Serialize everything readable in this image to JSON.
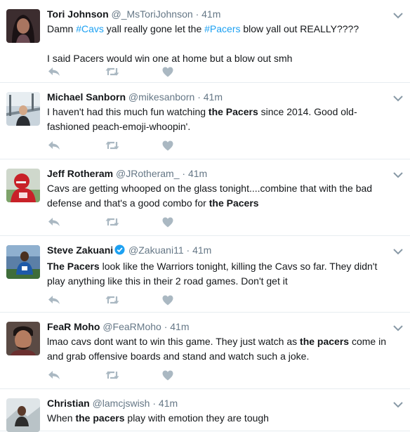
{
  "tweets": [
    {
      "name": "Tori Johnson",
      "handle": "@_MsToriJohnson",
      "sep": "·",
      "time": "41m",
      "verified": false,
      "avatar_icon": "avatar-woman",
      "lines": [
        [
          {
            "t": "Damn "
          },
          {
            "t": "#Cavs",
            "s": "link"
          },
          {
            "t": " yall really gone let the "
          },
          {
            "t": "#Pacers",
            "s": "link"
          },
          {
            "t": " blow yall out REALLY????"
          }
        ],
        [],
        [
          {
            "t": "I said Pacers would win one at home but a blow out smh"
          }
        ]
      ]
    },
    {
      "name": "Michael Sanborn",
      "handle": "@mikesanborn",
      "sep": "·",
      "time": "41m",
      "verified": false,
      "avatar_icon": "avatar-bridge",
      "lines": [
        [
          {
            "t": "I haven't had this much fun watching "
          },
          {
            "t": "the Pacers",
            "s": "bold"
          },
          {
            "t": " since 2014. Good old-fashioned peach-emoji-whoopin'."
          }
        ]
      ]
    },
    {
      "name": "Jeff Rotheram",
      "handle": "@JRotheram_",
      "sep": "·",
      "time": "41m",
      "verified": false,
      "avatar_icon": "avatar-football",
      "lines": [
        [
          {
            "t": "Cavs are getting whooped on the glass tonight....combine that with the bad defense and that's a good combo for "
          },
          {
            "t": "the Pacers",
            "s": "bold"
          }
        ]
      ]
    },
    {
      "name": "Steve Zakuani",
      "handle": "@Zakuani11",
      "sep": "·",
      "time": "41m",
      "verified": true,
      "avatar_icon": "avatar-soccer",
      "lines": [
        [
          {
            "t": "The Pacers",
            "s": "bold"
          },
          {
            "t": " look like the Warriors tonight, killing the Cavs so far. They didn't play anything like this in their 2 road games. Don't get it"
          }
        ]
      ]
    },
    {
      "name": "FeaR Moho",
      "handle": "@FeaRMoho",
      "sep": "·",
      "time": "41m",
      "verified": false,
      "avatar_icon": "avatar-man",
      "lines": [
        [
          {
            "t": "lmao cavs dont want to win this game. They just watch as "
          },
          {
            "t": "the pacers",
            "s": "bold"
          },
          {
            "t": " come in and grab offensive boards and stand and watch such a joke."
          }
        ]
      ]
    },
    {
      "name": "Christian",
      "handle": "@lamcjswish",
      "sep": "·",
      "time": "41m",
      "verified": false,
      "avatar_icon": "avatar-outdoor",
      "lines": [
        [
          {
            "t": "When "
          },
          {
            "t": "the pacers",
            "s": "bold"
          },
          {
            "t": " play with emotion they are tough"
          }
        ]
      ]
    }
  ],
  "icons": {
    "reply": "reply-icon",
    "retweet": "retweet-icon",
    "like": "heart-icon",
    "more": "chevron-down-icon",
    "verified": "verified-badge-icon"
  },
  "colors": {
    "link": "#1da1f2",
    "meta": "#657786",
    "action": "#aab8c2",
    "divider": "#e6ecf0"
  }
}
